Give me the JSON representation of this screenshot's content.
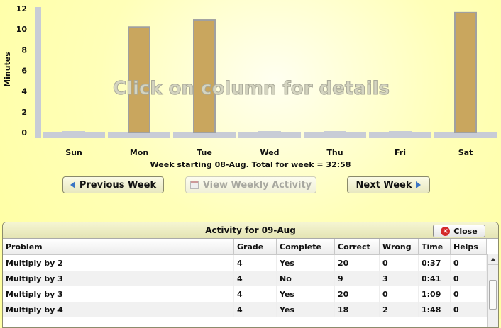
{
  "chart_data": {
    "type": "bar",
    "ylabel": "Minutes",
    "ylim": [
      0,
      12
    ],
    "yticks": [
      0,
      2,
      4,
      6,
      8,
      10,
      12
    ],
    "categories": [
      "Sun",
      "Mon",
      "Tue",
      "Wed",
      "Thu",
      "Fri",
      "Sat"
    ],
    "values": [
      0,
      10.2,
      10.9,
      0,
      0,
      0,
      11.6
    ],
    "overlay_text": "Click on column for details",
    "bar_color": "#c9a65e",
    "grid": false
  },
  "week_summary": "Week starting 08-Aug. Total for week = 32:58",
  "buttons": {
    "previous": "Previous Week",
    "weekly": "View Weekly Activity",
    "next": "Next Week"
  },
  "panel": {
    "title": "Activity for 09-Aug",
    "close_label": "Close",
    "columns": [
      "Problem",
      "Grade",
      "Complete",
      "Correct",
      "Wrong",
      "Time",
      "Helps"
    ],
    "rows": [
      [
        "Multiply by 2",
        "4",
        "Yes",
        "20",
        "0",
        "0:37",
        "0"
      ],
      [
        "Multiply by 3",
        "4",
        "No",
        "9",
        "3",
        "0:41",
        "0"
      ],
      [
        "Multiply by 3",
        "4",
        "Yes",
        "20",
        "0",
        "1:09",
        "0"
      ],
      [
        "Multiply by 4",
        "4",
        "Yes",
        "18",
        "2",
        "1:48",
        "0"
      ]
    ]
  }
}
